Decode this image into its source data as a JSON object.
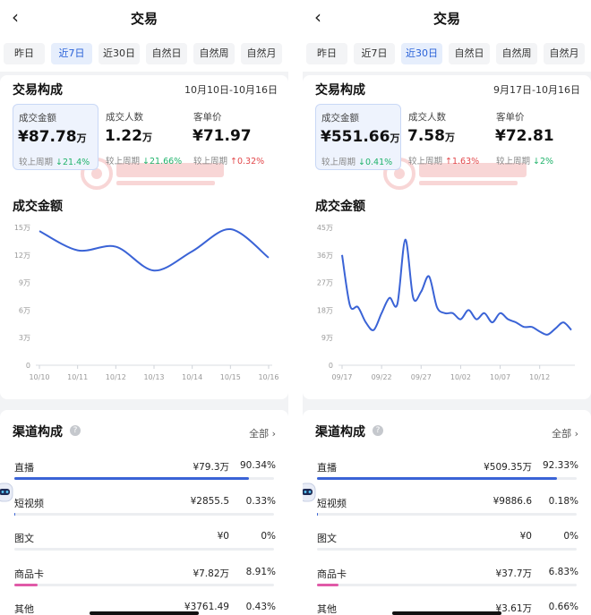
{
  "panels": [
    {
      "header": {
        "title": "交易"
      },
      "tabs": [
        {
          "label": "昨日",
          "active": false
        },
        {
          "label": "近7日",
          "active": true
        },
        {
          "label": "近30日",
          "active": false
        },
        {
          "label": "自然日",
          "active": false
        },
        {
          "label": "自然周",
          "active": false
        },
        {
          "label": "自然月",
          "active": false
        }
      ],
      "composition": {
        "title": "交易构成",
        "date_range": "10月10日-10月16日",
        "metrics": [
          {
            "label": "成交金额",
            "value": "¥87.78",
            "unit": "万",
            "compare_label": "较上周期",
            "change": "↓21.4%",
            "change_color": "green",
            "active": true
          },
          {
            "label": "成交人数",
            "value": "1.22",
            "unit": "万",
            "compare_label": "较上周期",
            "change": "↓21.66%",
            "change_color": "green",
            "active": false
          },
          {
            "label": "客单价",
            "value": "¥71.97",
            "unit": "",
            "compare_label": "较上周期",
            "change": "↑0.32%",
            "change_color": "red",
            "active": false
          }
        ]
      },
      "chart_data": {
        "type": "line",
        "title": "成交金额",
        "x": [
          "10/10",
          "10/11",
          "10/12",
          "10/13",
          "10/14",
          "10/15",
          "10/16"
        ],
        "xlabels": [
          "10/10",
          "10/11",
          "10/12",
          "10/13",
          "10/14",
          "10/15",
          "10/16"
        ],
        "values": [
          14.6,
          12.5,
          12.9,
          10.3,
          12.4,
          14.8,
          11.7
        ],
        "yticks": [
          "0",
          "3万",
          "6万",
          "9万",
          "12万",
          "15万"
        ],
        "ylim": [
          0,
          15
        ],
        "color": "#3a63d6"
      },
      "channels": {
        "title": "渠道构成",
        "all_label": "全部 ›",
        "rows": [
          {
            "name": "直播",
            "amount": "¥79.3万",
            "pct": "90.34%",
            "fraction": 0.9034,
            "color": "#3a63d6"
          },
          {
            "name": "短视频",
            "amount": "¥2855.5",
            "pct": "0.33%",
            "fraction": 0.0033,
            "color": "#3a63d6"
          },
          {
            "name": "图文",
            "amount": "¥0",
            "pct": "0%",
            "fraction": 0,
            "color": "#3a63d6"
          },
          {
            "name": "商品卡",
            "amount": "¥7.82万",
            "pct": "8.91%",
            "fraction": 0.0891,
            "color": "#e05aa8"
          },
          {
            "name": "其他",
            "amount": "¥3761.49",
            "pct": "0.43%",
            "fraction": 0.0043,
            "color": "#3a63d6"
          }
        ]
      }
    },
    {
      "header": {
        "title": "交易"
      },
      "tabs": [
        {
          "label": "昨日",
          "active": false
        },
        {
          "label": "近7日",
          "active": false
        },
        {
          "label": "近30日",
          "active": true
        },
        {
          "label": "自然日",
          "active": false
        },
        {
          "label": "自然周",
          "active": false
        },
        {
          "label": "自然月",
          "active": false
        }
      ],
      "composition": {
        "title": "交易构成",
        "date_range": "9月17日-10月16日",
        "metrics": [
          {
            "label": "成交金额",
            "value": "¥551.66",
            "unit": "万",
            "compare_label": "较上周期",
            "change": "↓0.41%",
            "change_color": "green",
            "active": true
          },
          {
            "label": "成交人数",
            "value": "7.58",
            "unit": "万",
            "compare_label": "较上周期",
            "change": "↑1.63%",
            "change_color": "red",
            "active": false
          },
          {
            "label": "客单价",
            "value": "¥72.81",
            "unit": "",
            "compare_label": "较上周期",
            "change": "↓2%",
            "change_color": "green",
            "active": false
          }
        ]
      },
      "chart_data": {
        "type": "line",
        "title": "成交金额",
        "x": [
          "09/17",
          "09/18",
          "09/19",
          "09/20",
          "09/21",
          "09/22",
          "09/23",
          "09/24",
          "09/25",
          "09/26",
          "09/27",
          "09/28",
          "09/29",
          "09/30",
          "10/01",
          "10/02",
          "10/03",
          "10/04",
          "10/05",
          "10/06",
          "10/07",
          "10/08",
          "10/09",
          "10/10",
          "10/11",
          "10/12",
          "10/13",
          "10/14",
          "10/15",
          "10/16"
        ],
        "xlabels": [
          "09/17",
          "09/22",
          "09/27",
          "10/02",
          "10/07",
          "10/12"
        ],
        "values": [
          36,
          19.5,
          19,
          14,
          11.5,
          17,
          22,
          20,
          41,
          22,
          24,
          29,
          19,
          17,
          17,
          15,
          18,
          15,
          17,
          14,
          17,
          15,
          14,
          12.5,
          12.5,
          11,
          10,
          12,
          14,
          11.5
        ],
        "yticks": [
          "0",
          "9万",
          "18万",
          "27万",
          "36万",
          "45万"
        ],
        "ylim": [
          0,
          45
        ],
        "color": "#3a63d6"
      },
      "channels": {
        "title": "渠道构成",
        "all_label": "全部 ›",
        "rows": [
          {
            "name": "直播",
            "amount": "¥509.35万",
            "pct": "92.33%",
            "fraction": 0.9233,
            "color": "#3a63d6"
          },
          {
            "name": "短视频",
            "amount": "¥9886.6",
            "pct": "0.18%",
            "fraction": 0.0018,
            "color": "#3a63d6"
          },
          {
            "name": "图文",
            "amount": "¥0",
            "pct": "0%",
            "fraction": 0,
            "color": "#3a63d6"
          },
          {
            "name": "商品卡",
            "amount": "¥37.7万",
            "pct": "6.83%",
            "fraction": 0.0683,
            "color": "#e05aa8"
          },
          {
            "name": "其他",
            "amount": "¥3.61万",
            "pct": "0.66%",
            "fraction": 0.0066,
            "color": "#3a63d6"
          }
        ]
      }
    }
  ]
}
